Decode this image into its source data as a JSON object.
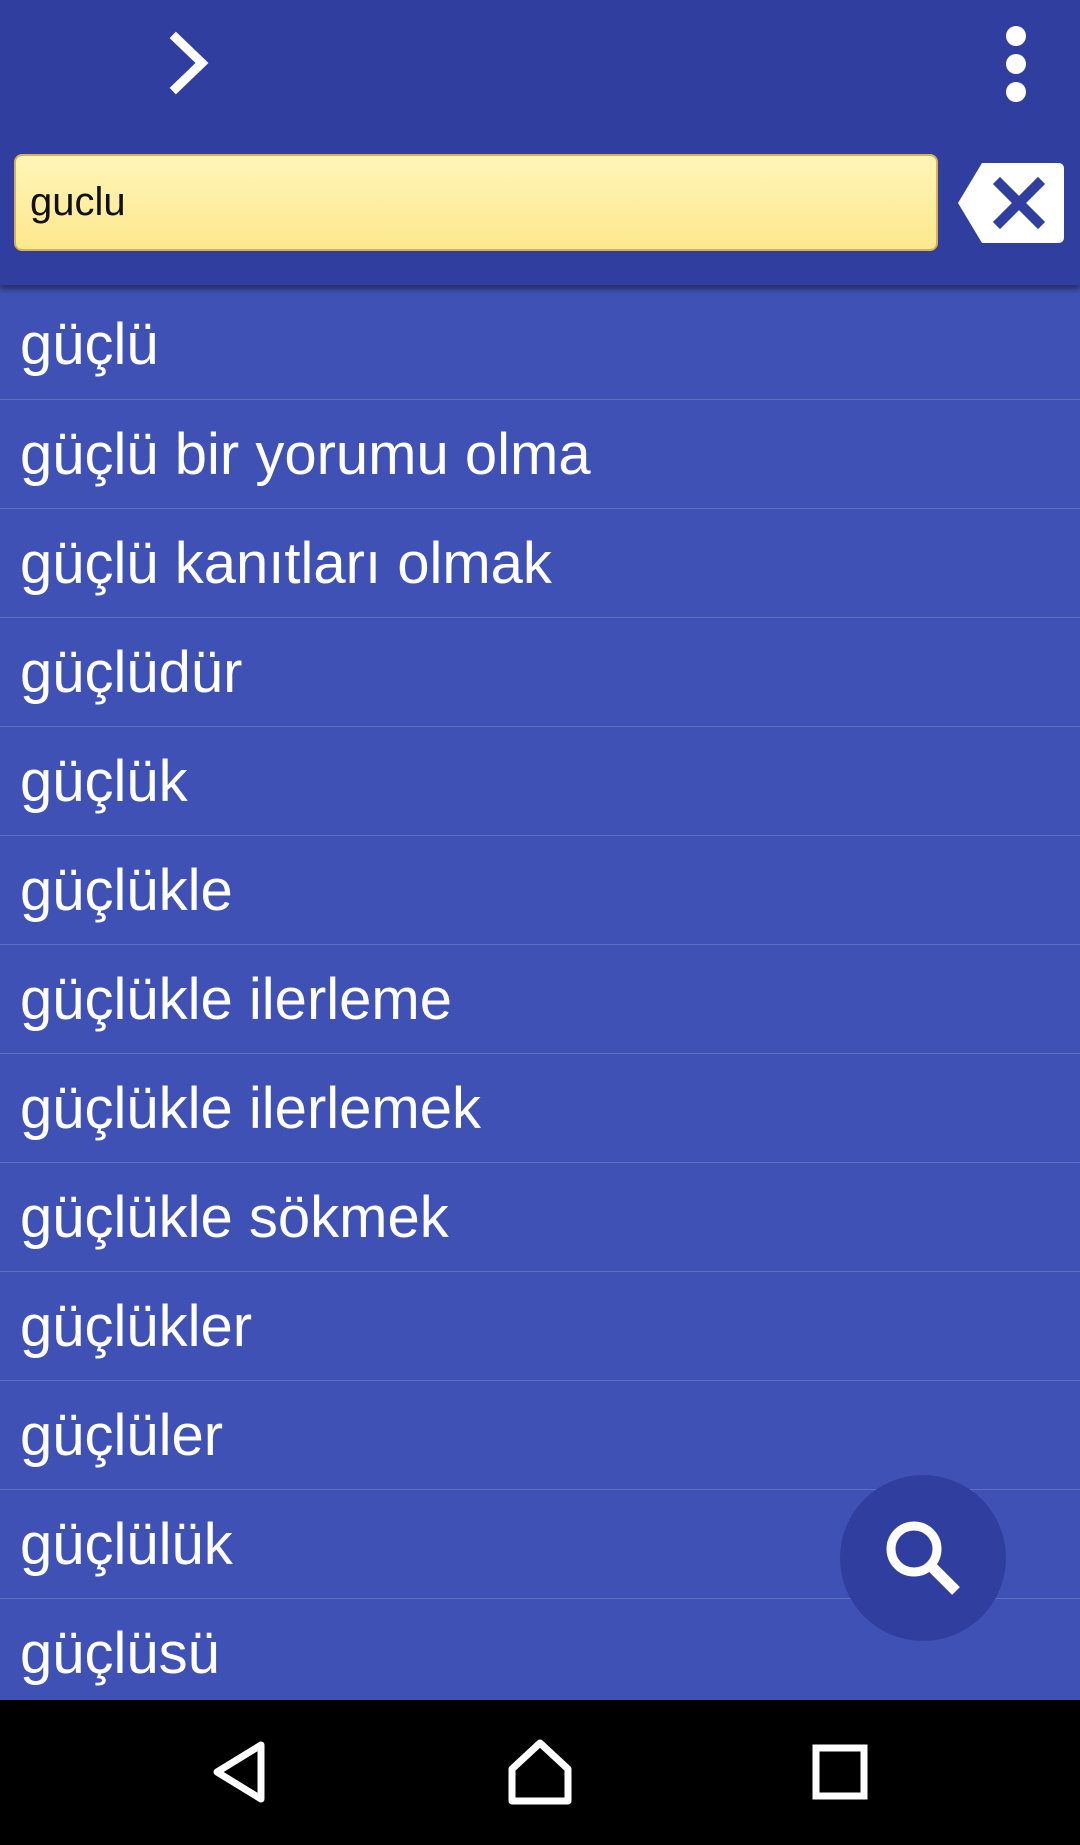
{
  "toolbar": {
    "forward_icon": "chevron-right-icon",
    "menu_icon": "more-vert-icon",
    "accent_color": "#303f9f"
  },
  "search": {
    "value": "guclu",
    "clear_icon": "backspace-clear-icon"
  },
  "results": [
    "güçlü",
    "güçlü bir yorumu olma",
    "güçlü kanıtları olmak",
    "güçlüdür",
    "güçlük",
    "güçlükle",
    "güçlükle ilerleme",
    "güçlükle ilerlemek",
    "güçlükle sökmek",
    "güçlükler",
    "güçlüler",
    "güçlülük",
    "güçlüsü"
  ],
  "fab": {
    "icon": "search-icon"
  },
  "navbar": {
    "back_icon": "back-triangle-icon",
    "home_icon": "home-icon",
    "recents_icon": "recents-square-icon"
  },
  "colors": {
    "toolbar": "#303f9f",
    "list_background": "#3f51b5",
    "search_field": "#fdef9f"
  }
}
